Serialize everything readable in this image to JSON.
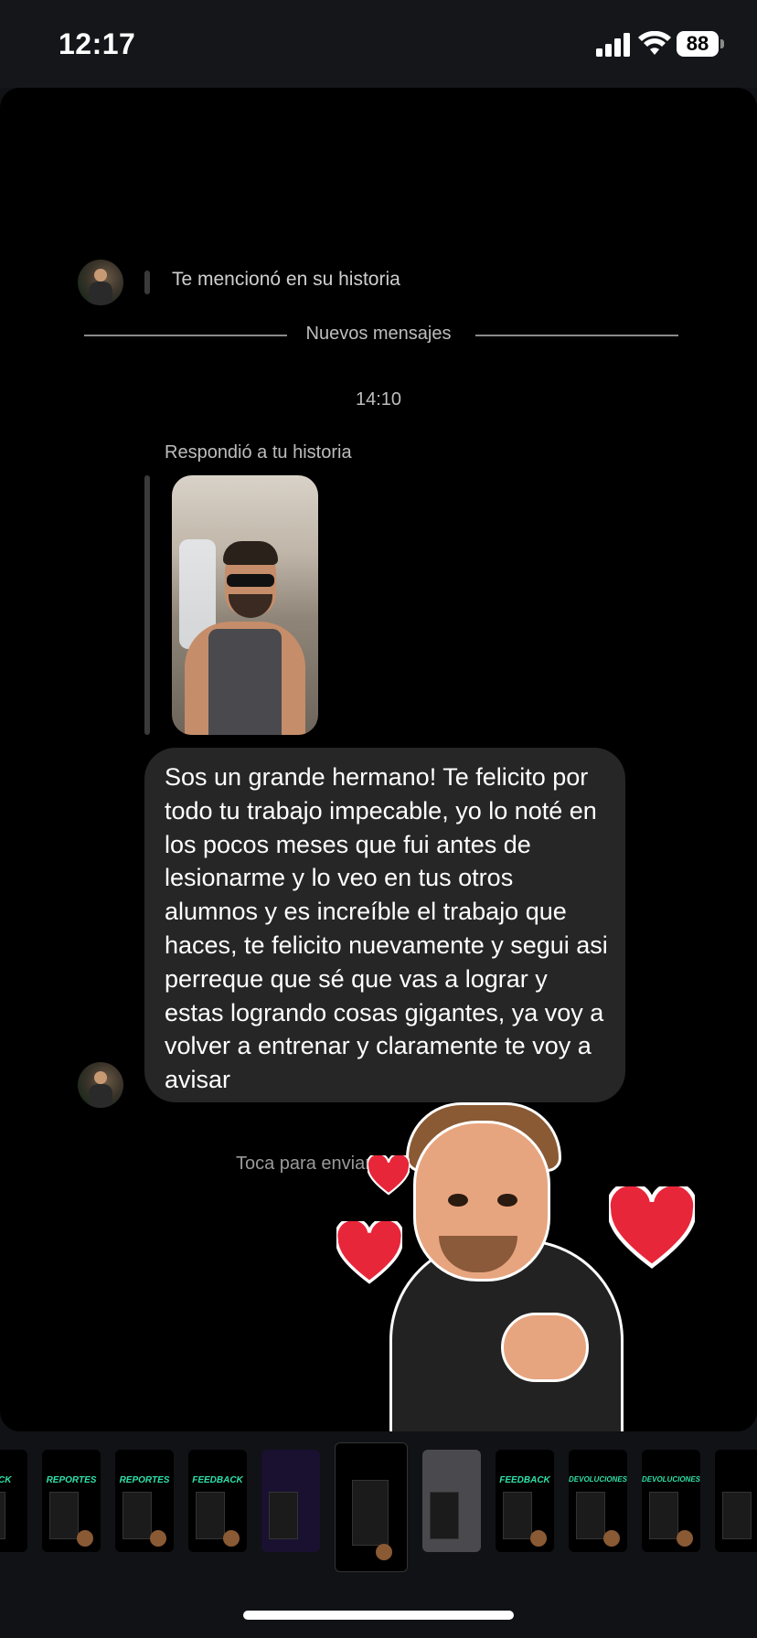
{
  "status_bar": {
    "time": "12:17",
    "battery": "88",
    "icons": [
      "signal-icon",
      "wifi-icon",
      "battery-icon"
    ]
  },
  "chat": {
    "mention": "Te mencionó en su historia",
    "divider": "Nuevos mensajes",
    "timestamp": "14:10",
    "reply_label": "Respondió a tu historia",
    "message": "Sos un grande hermano! Te felicito por todo tu trabajo impecable, yo lo noté en los pocos meses que fui antes de lesionarme y lo veo en tus otros alumnos y es increíble el trabajo que haces, te felicito nuevamente y segui asi perreque que sé que vas a lograr y estas logrando cosas gigantes, ya voy a volver a entrenar y claramente te voy a avisar",
    "reaction_hint": "Toca para enviar una rea"
  },
  "thumbnails": [
    {
      "label": "BACK"
    },
    {
      "label": "REPORTES"
    },
    {
      "label": "REPORTES"
    },
    {
      "label": "FEEDBACK"
    },
    {
      "label": ""
    },
    {
      "label": ""
    },
    {
      "label": ""
    },
    {
      "label": "FEEDBACK"
    },
    {
      "label": "DEVOLUCIONES"
    },
    {
      "label": "DEVOLUCIONES"
    },
    {
      "label": ""
    }
  ],
  "colors": {
    "accent_green": "#30e0a8",
    "bubble": "#262626",
    "heart": "#e8263a"
  }
}
